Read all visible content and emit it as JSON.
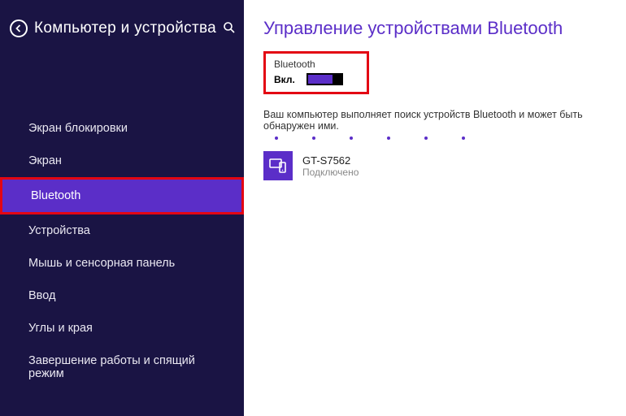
{
  "sidebar": {
    "title": "Компьютер и устройства",
    "items": [
      {
        "label": "Экран блокировки"
      },
      {
        "label": "Экран"
      },
      {
        "label": "Bluetooth"
      },
      {
        "label": "Устройства"
      },
      {
        "label": "Мышь и сенсорная панель"
      },
      {
        "label": "Ввод"
      },
      {
        "label": "Углы и края"
      },
      {
        "label": "Завершение работы и спящий режим"
      }
    ]
  },
  "main": {
    "title": "Управление устройствами Bluetooth",
    "bluetooth_label": "Bluetooth",
    "bluetooth_state": "Вкл.",
    "scan_text": "Ваш компьютер выполняет поиск устройств Bluetooth и может быть обнаружен ими."
  },
  "device": {
    "name": "GT-S7562",
    "status": "Подключено"
  }
}
